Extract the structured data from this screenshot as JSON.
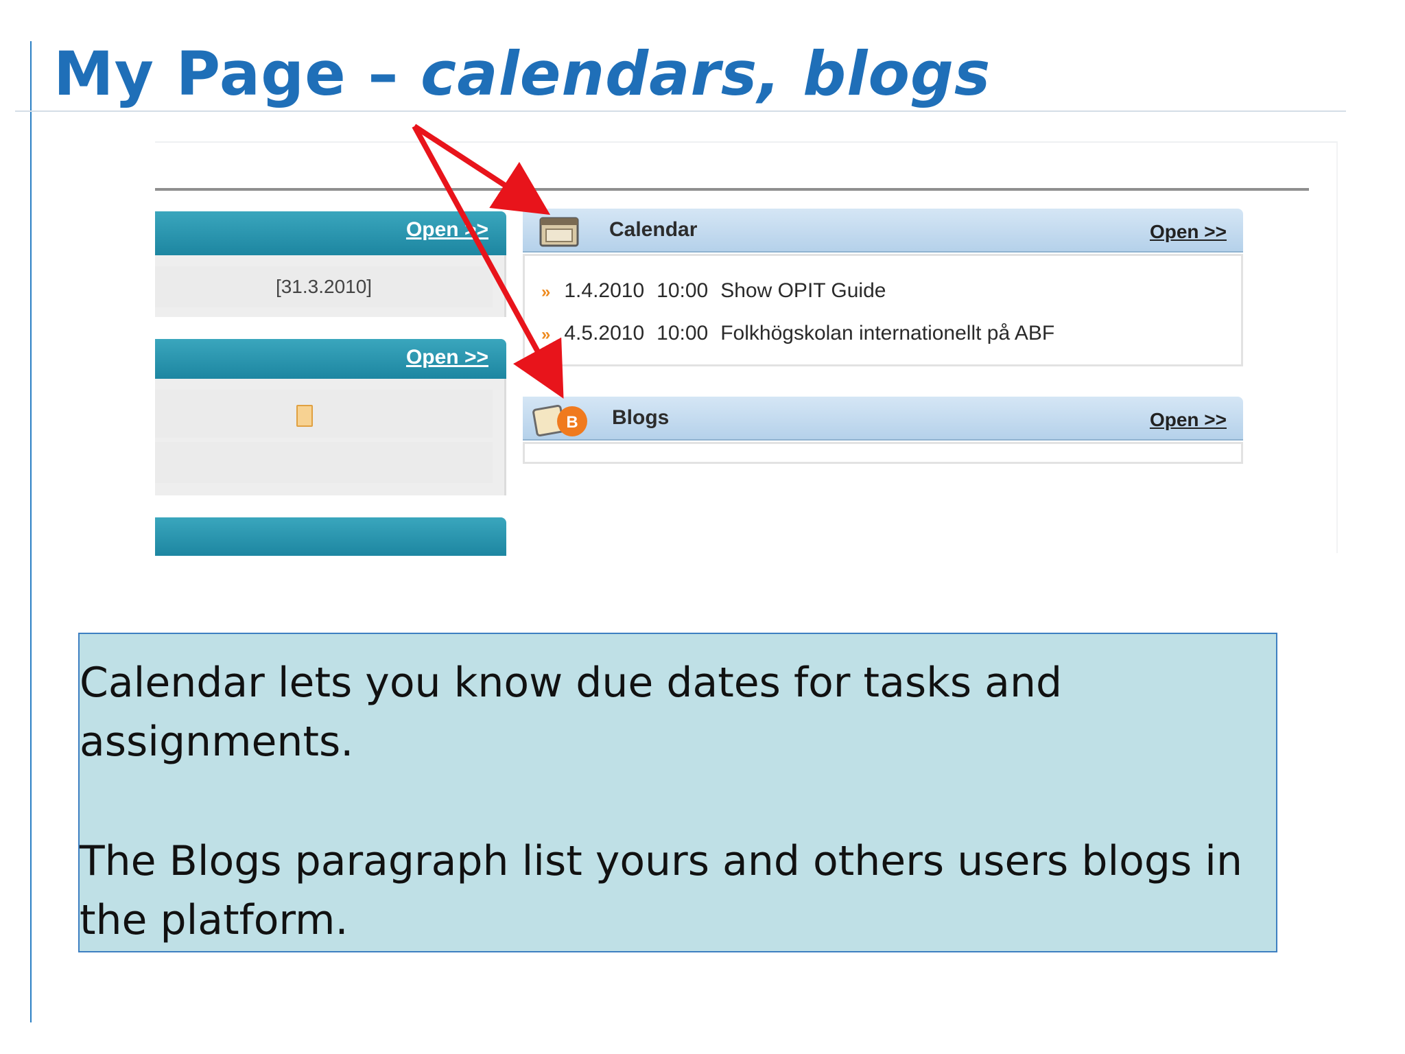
{
  "slide": {
    "title_main": "My Page – ",
    "title_italic": "calendars, blogs"
  },
  "left_panel": {
    "open_label_1": "Open >>",
    "date": "[31.3.2010]",
    "open_label_2": "Open >>"
  },
  "calendar": {
    "title": "Calendar",
    "open_label": "Open >>",
    "events": [
      {
        "marker": "»",
        "date": "1.4.2010",
        "time": "10:00",
        "title": "Show OPIT Guide"
      },
      {
        "marker": "»",
        "date": "4.5.2010",
        "time": "10:00",
        "title": "Folkhögskolan internationellt på ABF"
      }
    ]
  },
  "blogs": {
    "title": "Blogs",
    "open_label": "Open >>"
  },
  "description": {
    "para1": "Calendar lets you know due dates for tasks and assignments.",
    "para2": "The Blogs paragraph list yours and others users blogs in the platform."
  },
  "colors": {
    "title_blue": "#1f6fb8",
    "teal_bar": "#1d86a1",
    "widget_bar": "#c3dbef",
    "arrow_red": "#e8141b",
    "desc_bg": "#bfe0e6"
  }
}
